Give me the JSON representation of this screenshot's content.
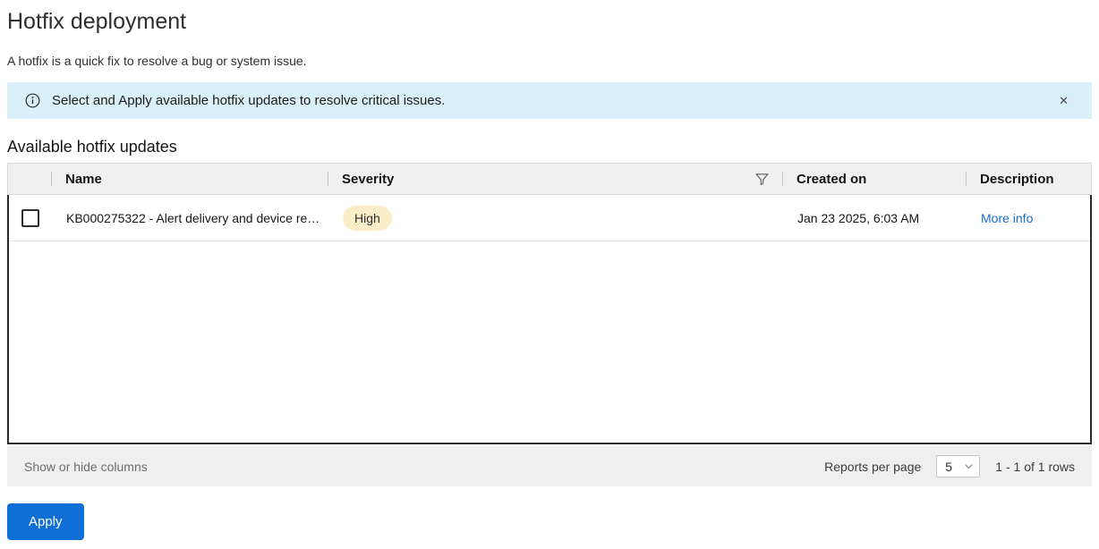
{
  "page": {
    "title": "Hotfix deployment",
    "subtitle": "A hotfix is a quick fix to resolve a bug or system issue."
  },
  "banner": {
    "message": "Select and Apply available hotfix updates to resolve critical issues.",
    "close_glyph": "✕"
  },
  "table": {
    "section_title": "Available hotfix updates",
    "columns": {
      "name": "Name",
      "severity": "Severity",
      "created_on": "Created on",
      "description": "Description"
    },
    "rows": [
      {
        "name": "KB000275322 - Alert delivery and device re…",
        "severity": "High",
        "created_on": "Jan 23 2025, 6:03 AM",
        "description_link": "More info"
      }
    ],
    "footer": {
      "show_hide_label": "Show or hide columns",
      "reports_per_page_label": "Reports per page",
      "page_size": "5",
      "rows_summary": "1 - 1 of 1 rows"
    }
  },
  "actions": {
    "apply_label": "Apply"
  },
  "colors": {
    "banner_bg": "#d9f0f9",
    "badge_high_bg": "#faeec9",
    "link_blue": "#156cd2",
    "apply_button_bg": "#0f6fd7",
    "table_header_bg": "#f0f0f0",
    "table_footer_bg": "#efefef"
  }
}
